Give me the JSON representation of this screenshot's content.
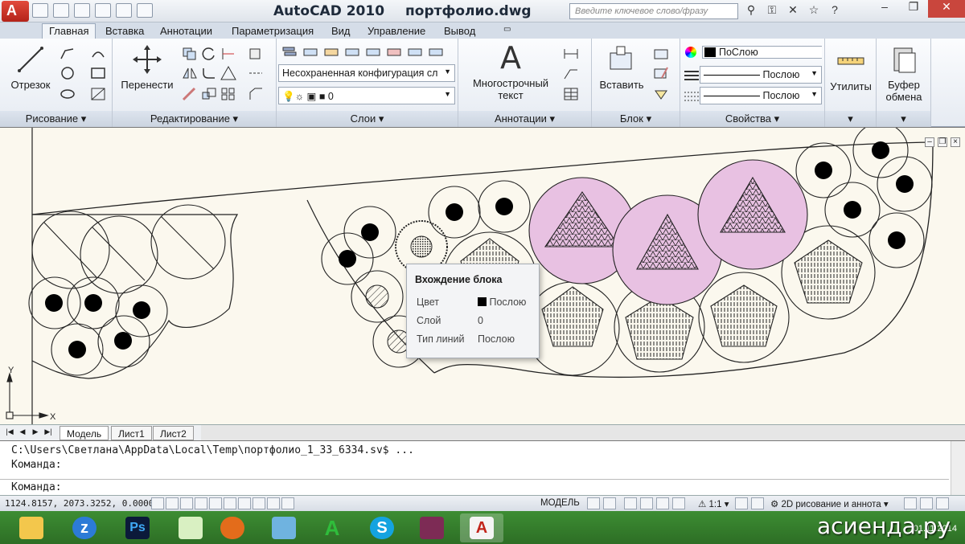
{
  "titlebar": {
    "app": "AutoCAD 2010",
    "file": "портфолио.dwg",
    "search_placeholder": "Введите ключевое слово/фразу"
  },
  "tabs": [
    "Главная",
    "Вставка",
    "Аннотации",
    "Параметризация",
    "Вид",
    "Управление",
    "Вывод"
  ],
  "ribbon": {
    "draw": {
      "title": "Рисование",
      "line_label": "Отрезок"
    },
    "modify": {
      "title": "Редактирование",
      "move_label": "Перенести"
    },
    "layers": {
      "title": "Слои",
      "state_combo": "Несохраненная конфигурация сл",
      "layer_combo": "0"
    },
    "annotation": {
      "title": "Аннотации",
      "mtext_label_1": "Многострочный",
      "mtext_label_2": "текст"
    },
    "block": {
      "title": "Блок",
      "insert_label": "Вставить"
    },
    "properties": {
      "title": "Свойства",
      "color": "ПоСлою",
      "linetype": "Послою",
      "lineweight": "Послою"
    },
    "utilities": {
      "label": "Утилиты"
    },
    "clipboard": {
      "label_1": "Буфер",
      "label_2": "обмена"
    }
  },
  "tooltip": {
    "title": "Вхождение блока",
    "rows": [
      {
        "key": "Цвет",
        "value": "Послою"
      },
      {
        "key": "Слой",
        "value": "0"
      },
      {
        "key": "Тип линий",
        "value": "Послою"
      }
    ]
  },
  "ucs": {
    "x": "X",
    "y": "Y"
  },
  "layout_tabs": [
    "Модель",
    "Лист1",
    "Лист2"
  ],
  "command": {
    "line1": "C:\\Users\\Светлана\\AppData\\Local\\Temp\\портфолио_1_33_6334.sv$ ...",
    "line2": "Команда:",
    "prompt": "Команда:"
  },
  "status": {
    "coords": "1124.8157, 2073.3252, 0.0000",
    "model": "МОДЕЛЬ",
    "scale": "1:1",
    "workspace": "2D рисование и аннота"
  },
  "taskbar": {
    "date": "01.11.2014"
  },
  "watermark": "асиенда.ру",
  "colors": {
    "pink_fill": "#e8c1e2",
    "accent": "#d5dde8"
  }
}
